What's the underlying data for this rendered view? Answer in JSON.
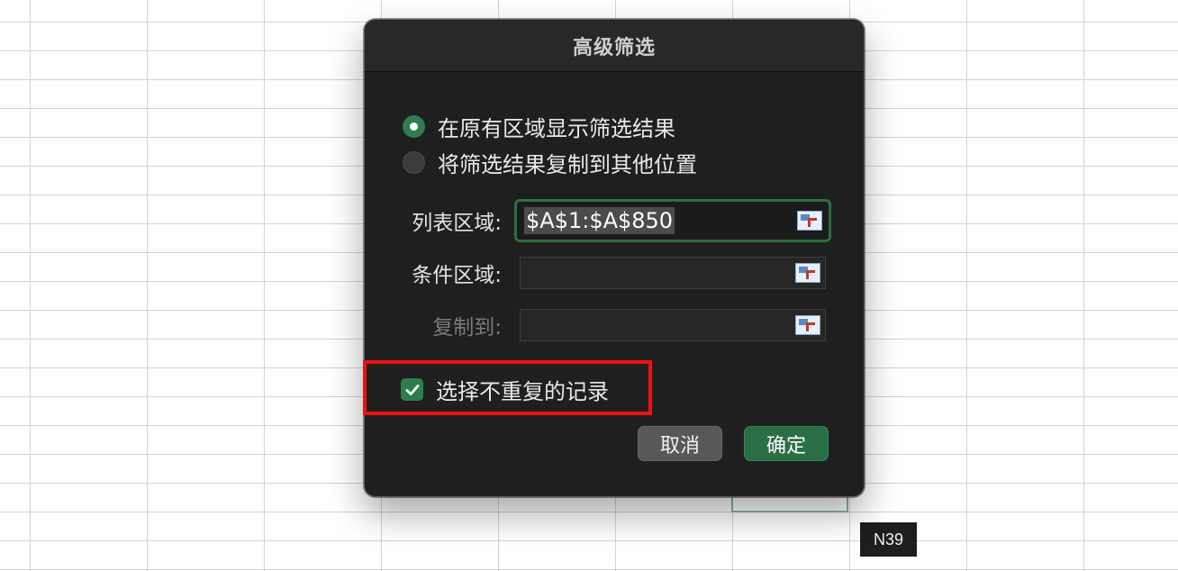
{
  "spreadsheet": {
    "tooltip": "N39"
  },
  "dialog": {
    "title": "高级筛选",
    "radios": [
      {
        "label": "在原有区域显示筛选结果",
        "checked": true
      },
      {
        "label": "将筛选结果复制到其他位置",
        "checked": false
      }
    ],
    "fields": {
      "list_range": {
        "label": "列表区域:",
        "value": "$A$1:$A$850"
      },
      "criteria_range": {
        "label": "条件区域:",
        "value": ""
      },
      "copy_to": {
        "label": "复制到:",
        "value": "",
        "disabled": true
      }
    },
    "unique_records": {
      "label": "选择不重复的记录",
      "checked": true
    },
    "buttons": {
      "cancel": "取消",
      "ok": "确定"
    },
    "colors": {
      "accent": "#2e7d4f",
      "highlight": "#ee1111",
      "background": "#1f1f1f"
    },
    "icons": [
      "range-selector-icon",
      "checkmark-icon"
    ]
  }
}
